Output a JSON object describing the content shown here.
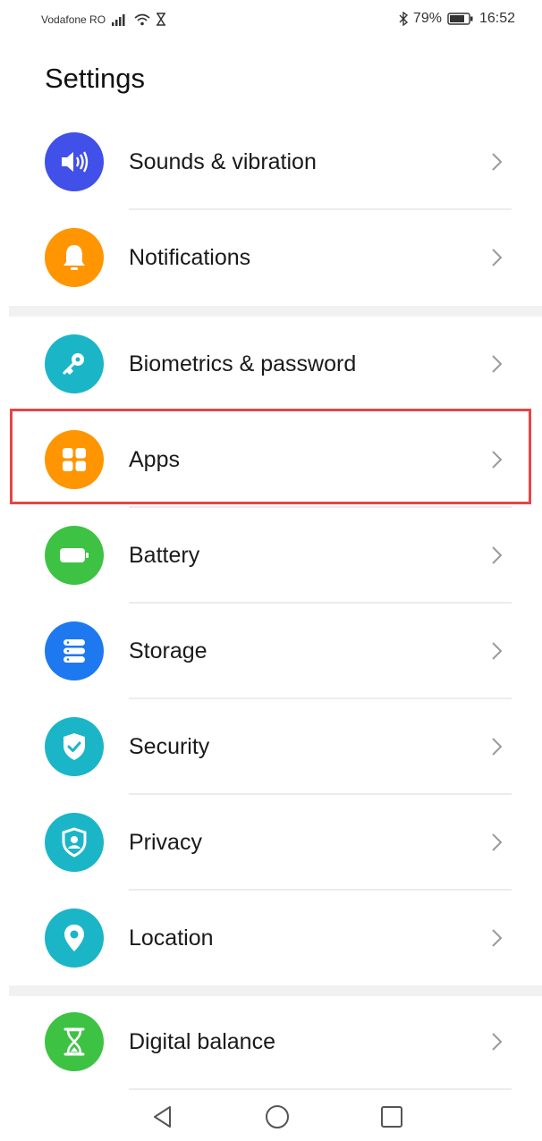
{
  "status_bar": {
    "carrier": "Vodafone RO",
    "battery": "79%",
    "time": "16:52",
    "icons": [
      "signal-icon",
      "wifi-icon",
      "hourglass-icon",
      "bluetooth-icon",
      "battery-icon"
    ]
  },
  "page_title": "Settings",
  "sections": [
    {
      "items": [
        {
          "label": "Sounds & vibration",
          "icon": "speaker-icon",
          "color": "#4050e8"
        },
        {
          "label": "Notifications",
          "icon": "bell-icon",
          "color": "#ff9500"
        }
      ]
    },
    {
      "items": [
        {
          "label": "Biometrics & password",
          "icon": "key-icon",
          "color": "#1bb5c8"
        },
        {
          "label": "Apps",
          "icon": "apps-grid-icon",
          "color": "#ff9500",
          "highlighted": true
        },
        {
          "label": "Battery",
          "icon": "battery-icon",
          "color": "#3ec244"
        },
        {
          "label": "Storage",
          "icon": "storage-icon",
          "color": "#1e78f0"
        },
        {
          "label": "Security",
          "icon": "shield-check-icon",
          "color": "#1bb5c8"
        },
        {
          "label": "Privacy",
          "icon": "privacy-shield-icon",
          "color": "#1bb5c8"
        },
        {
          "label": "Location",
          "icon": "location-pin-icon",
          "color": "#1bb5c8"
        }
      ]
    },
    {
      "items": [
        {
          "label": "Digital balance",
          "icon": "hourglass-icon",
          "color": "#3ec244"
        }
      ]
    }
  ],
  "highlight_color": "#e64545",
  "nav_bar": {
    "buttons": [
      "back-triangle-icon",
      "home-circle-icon",
      "recents-square-icon"
    ]
  }
}
